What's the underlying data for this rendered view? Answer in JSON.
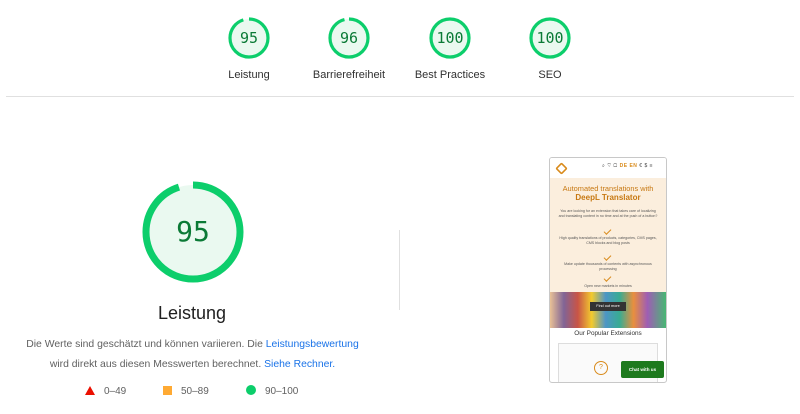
{
  "summary": [
    {
      "score": "95",
      "label": "Leistung",
      "fraction": 0.95
    },
    {
      "score": "96",
      "label": "Barrierefreiheit",
      "fraction": 0.96
    },
    {
      "score": "100",
      "label": "Best Practices",
      "fraction": 1.0
    },
    {
      "score": "100",
      "label": "SEO",
      "fraction": 1.0
    }
  ],
  "main": {
    "score": "95",
    "fraction": 0.95,
    "title": "Leistung",
    "desc_part1": "Die Werte sind geschätzt und können variieren. Die ",
    "desc_link1": "Leistungsbewertung",
    "desc_part2": "wird direkt aus diesen Messwerten berechnet. ",
    "desc_link2": "Siehe Rechner."
  },
  "legend": [
    {
      "range": "0–49"
    },
    {
      "range": "50–89"
    },
    {
      "range": "90–100"
    }
  ],
  "colors": {
    "pass": "#0cce6b",
    "pass_text": "#0b7a36",
    "pass_bg": "#eaf9f0",
    "average": "#ffaa33",
    "fail": "#eb0f00",
    "link": "#1a73e8"
  },
  "screenshot": {
    "header_icons": "DE EN",
    "hero_title": "Automated translations with",
    "hero_title_strong": "DeepL Translator",
    "intro": "You are looking for an extension that takes care of localizing and translating content in no time and at the push of a button?",
    "feature1": "High quality translations of products, categories, CMS pages, CMS blocks and blog posts",
    "feature2": "Make update thousands of contents with asynchronous processing",
    "feature3": "Open new markets in minutes",
    "cta": "Find out more",
    "section_title": "Our Popular Extensions",
    "chat": "Chat with us"
  }
}
